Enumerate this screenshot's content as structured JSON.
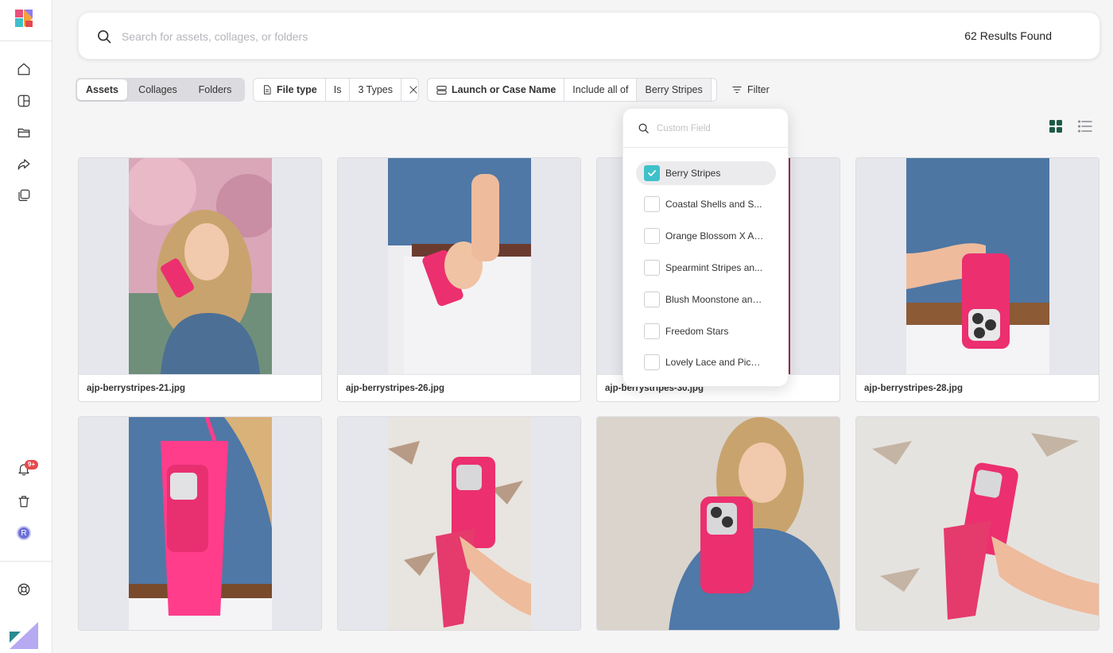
{
  "search": {
    "placeholder": "Search for assets, collages, or folders",
    "results_count": "62 Results Found"
  },
  "tabs": [
    {
      "label": "Assets",
      "active": true
    },
    {
      "label": "Collages",
      "active": false
    },
    {
      "label": "Folders",
      "active": false
    }
  ],
  "filters": {
    "file_type": {
      "field": "File type",
      "operator": "Is",
      "value": "3 Types"
    },
    "launch": {
      "field": "Launch or Case Name",
      "operator": "Include all of",
      "value": "Berry Stripes"
    },
    "filter_button": "Filter"
  },
  "dropdown": {
    "placeholder": "Custom Field",
    "options": [
      {
        "label": "Berry Stripes",
        "checked": true
      },
      {
        "label": "Coastal Shells and S...",
        "checked": false
      },
      {
        "label": "Orange Blossom X Amb...",
        "checked": false
      },
      {
        "label": "Spearmint Stripes an...",
        "checked": false
      },
      {
        "label": "Blush Moonstone and ...",
        "checked": false
      },
      {
        "label": "Freedom Stars",
        "checked": false
      },
      {
        "label": "Lovely Lace and Picn...",
        "checked": false
      }
    ]
  },
  "sidebar": {
    "notification_badge": "9+",
    "avatar_initial": "R",
    "icons": [
      "home-icon",
      "collage-icon",
      "folder-icon",
      "share-icon",
      "library-icon",
      "bell-icon",
      "trash-icon",
      "help-icon"
    ]
  },
  "assets": [
    {
      "filename": "ajp-berrystripes-21.jpg"
    },
    {
      "filename": "ajp-berrystripes-26.jpg"
    },
    {
      "filename": "ajp-berrystripes-30.jpg"
    },
    {
      "filename": "ajp-berrystripes-28.jpg"
    },
    {
      "filename": ""
    },
    {
      "filename": ""
    },
    {
      "filename": ""
    },
    {
      "filename": ""
    }
  ],
  "colors": {
    "accent_teal": "#3fc1c9",
    "badge_red": "#e5484d",
    "grid_toggle_green": "#1e5b47",
    "phone_case_pink": "#ec2f6f"
  }
}
